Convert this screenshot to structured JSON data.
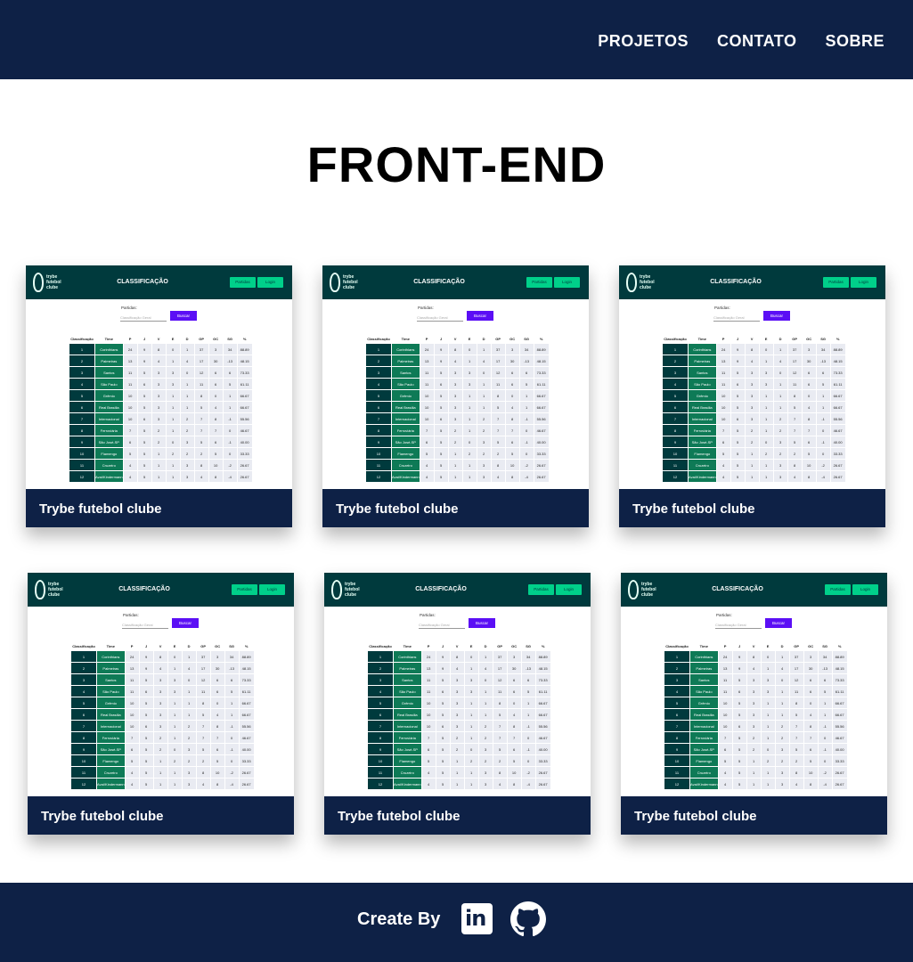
{
  "nav": {
    "items": [
      "PROJETOS",
      "CONTATO",
      "SOBRE"
    ]
  },
  "page": {
    "title": "FRONT-END"
  },
  "colors": {
    "header_bg": "#0e2146",
    "app_header": "#003a3d",
    "app_accent": "#00d08a",
    "app_button": "#5b0ff5"
  },
  "preview": {
    "logo_text_1": "trybe",
    "logo_text_2": "futebol",
    "logo_text_3": "clube",
    "title": "CLASSIFICAÇÃO",
    "btn_partidas": "Partidas",
    "btn_login": "Login",
    "filter_label": "Partidas:",
    "filter_placeholder": "Classificação Geral",
    "search_label": "Buscar",
    "headers": [
      "Classificação",
      "Time",
      "P",
      "J",
      "V",
      "E",
      "D",
      "GP",
      "GC",
      "SG",
      "%"
    ],
    "rows": [
      [
        "1",
        "Corinthians",
        "24",
        "9",
        "8",
        "0",
        "1",
        "37",
        "3",
        "34",
        "88.89"
      ],
      [
        "2",
        "Palmeiras",
        "13",
        "9",
        "4",
        "1",
        "4",
        "17",
        "30",
        "-13",
        "48.15"
      ],
      [
        "3",
        "Santos",
        "11",
        "5",
        "3",
        "3",
        "0",
        "12",
        "6",
        "6",
        "73.33"
      ],
      [
        "4",
        "São Paulo",
        "11",
        "6",
        "3",
        "3",
        "1",
        "11",
        "6",
        "5",
        "61.11"
      ],
      [
        "5",
        "Grêmio",
        "10",
        "5",
        "3",
        "1",
        "1",
        "8",
        "0",
        "1",
        "66.67"
      ],
      [
        "6",
        "Real Brasília",
        "10",
        "5",
        "3",
        "1",
        "1",
        "5",
        "4",
        "1",
        "66.67"
      ],
      [
        "7",
        "Internacional",
        "10",
        "6",
        "3",
        "1",
        "2",
        "7",
        "8",
        "-1",
        "55.56"
      ],
      [
        "8",
        "Ferroviária",
        "7",
        "5",
        "2",
        "1",
        "2",
        "7",
        "7",
        "0",
        "46.67"
      ],
      [
        "9",
        "São José-SP",
        "6",
        "5",
        "2",
        "0",
        "3",
        "5",
        "6",
        "-1",
        "40.00"
      ],
      [
        "10",
        "Flamengo",
        "5",
        "5",
        "1",
        "2",
        "2",
        "2",
        "5",
        "0",
        "33.33"
      ],
      [
        "11",
        "Cruzeiro",
        "4",
        "5",
        "1",
        "1",
        "3",
        "8",
        "10",
        "-2",
        "26.67"
      ],
      [
        "12",
        "Avaí/Kindermann",
        "4",
        "5",
        "1",
        "1",
        "3",
        "4",
        "8",
        "-4",
        "26.67"
      ]
    ]
  },
  "projects": [
    {
      "caption": "Trybe futebol clube"
    },
    {
      "caption": "Trybe futebol clube"
    },
    {
      "caption": "Trybe futebol clube"
    },
    {
      "caption": "Trybe futebol clube"
    },
    {
      "caption": "Trybe futebol clube"
    },
    {
      "caption": "Trybe futebol clube"
    }
  ],
  "footer": {
    "created_by": "Create By",
    "linkedin_icon": "linkedin-icon",
    "linkedin_glyph": "in",
    "github_icon": "github-icon"
  }
}
